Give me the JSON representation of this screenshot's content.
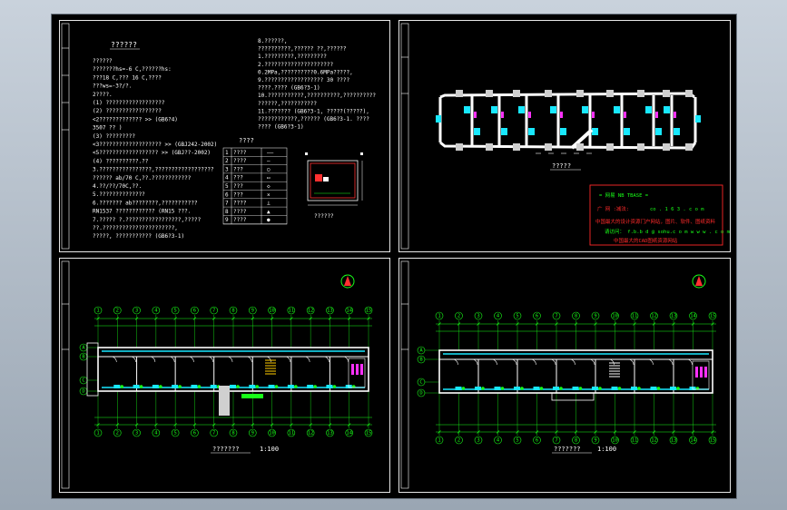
{
  "viewport": {
    "background": "#b8c2cc",
    "canvas_bg": "#000000"
  },
  "colors": {
    "frame": "#ffffff",
    "dim": "#18ff18",
    "wall": "#ffffff",
    "pipe": "#18e8ff",
    "fixture": "#ff30ff",
    "stamp_border": "#ff2a2a"
  },
  "sheet_notes": {
    "title": "??????",
    "left_lines": [
      "??????",
      "???????hs=-6 C,??????hs:",
      "???18 C,??? 16 C,????",
      "???ws=-3?/?.",
      "2????.",
      "(1) ??????????????????",
      "(2) ?????????????????",
      "<2?????????????   >> (GB6?4)",
      "3507 ??                )",
      "(3) ?????????",
      "<3??????????????????? >> (GBJ242-2002)",
      "<5?????????????????? >> (GBJ??-2002)",
      "(4) ??????????.??",
      "3.????????????????,??????????????????",
      "?????? ab/70 C,??.????????????",
      "4.??/??/70C,??.",
      "5.??????????????",
      "6.??????? ab????????,???????????",
      "RN1537 ???????????? (RN15    ???.",
      "7.?????   ?.?????????????????,?????",
      "??.??????????????????????,",
      "?????, ??????????? (GB6?3-1)"
    ],
    "right_lines": [
      "8.??????,",
      "??????????,?????? ??,??????",
      "1.?????????,?????????",
      "2.?????????????????????",
      "0.2MPa,??????????0.6MPa?????,",
      "9.??????????????????    30    ????",
      "????.????   (GB6?3-1)",
      "10.???????????,??????????,??????????",
      "??????,???????????",
      "11.??????? (GB6?3-1,    ?????(?????),",
      "????????????,??????   (GB6?3-1.    ????",
      "????  (GB6?3-1)"
    ],
    "legend_title": "????",
    "legend_rows": [
      [
        "1",
        "????",
        "——"
      ],
      [
        "2",
        "????",
        "—"
      ],
      [
        "3",
        "???",
        "○"
      ],
      [
        "4",
        "???",
        "▭"
      ],
      [
        "5",
        "???",
        "◇"
      ],
      [
        "6",
        "???",
        "×"
      ],
      [
        "7",
        "????",
        "⊥"
      ],
      [
        "8",
        "????",
        "▲"
      ],
      [
        "9",
        "????",
        "●"
      ]
    ],
    "detail_caption": "??????"
  },
  "sheet_system": {
    "caption": "?????",
    "stamp": {
      "line1": "=   网易   NB TBASE   =",
      "line2_red": "广 网   :减法:",
      "line2_red_b": "co . 1 6 3 . c o m",
      "line3": "中国最大的设计资源门户网站，图片、软件、图纸资料",
      "line4": "请访问：  f.b.b d @ sohu.c o m  w w w . c o m",
      "line5_red": "中国最大的CAD图纸资源网站"
    }
  },
  "sheet_plan1": {
    "caption": "???????",
    "scale": "1:100",
    "top_axes": [
      "1",
      "2",
      "3",
      "4",
      "5",
      "6",
      "7",
      "8",
      "9",
      "10",
      "11",
      "12",
      "13",
      "14",
      "15"
    ],
    "bottom_axes": [
      "1",
      "2",
      "3",
      "4",
      "5",
      "6",
      "7",
      "8",
      "9",
      "10",
      "11",
      "12",
      "13",
      "14",
      "15"
    ],
    "left_axes": [
      "A",
      "B",
      "C",
      "D"
    ]
  },
  "sheet_plan2": {
    "caption": "???????",
    "scale": "1:100",
    "top_axes": [
      "1",
      "2",
      "3",
      "4",
      "5",
      "6",
      "7",
      "8",
      "9",
      "10",
      "11",
      "12",
      "13",
      "14",
      "15"
    ],
    "bottom_axes": [
      "1",
      "2",
      "3",
      "4",
      "5",
      "6",
      "7",
      "8",
      "9",
      "10",
      "11",
      "12",
      "13",
      "14",
      "15"
    ],
    "left_axes": [
      "A",
      "B",
      "C",
      "D"
    ]
  }
}
